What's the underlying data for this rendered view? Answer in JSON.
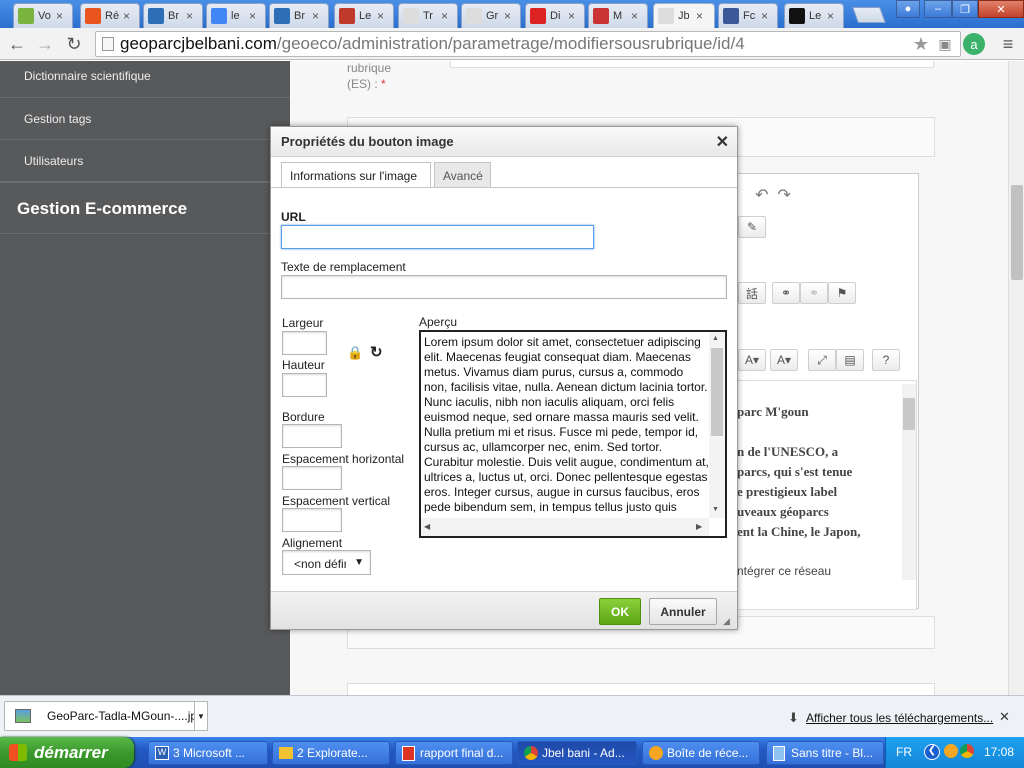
{
  "browser": {
    "tabs": [
      {
        "label": "Vo",
        "fav": "#7ab43e"
      },
      {
        "label": "Ré",
        "fav": "#e8551d"
      },
      {
        "label": "Br",
        "fav": "#2c6fb7"
      },
      {
        "label": "le",
        "fav": "#4285f4"
      },
      {
        "label": "Br",
        "fav": "#2c6fb7"
      },
      {
        "label": "Le",
        "fav": "#c0392b"
      },
      {
        "label": "Tr",
        "fav": "#dddddd"
      },
      {
        "label": "Gr",
        "fav": "#dddddd"
      },
      {
        "label": "Di",
        "fav": "#d22"
      },
      {
        "label": "M",
        "fav": "#c33"
      },
      {
        "label": "Jb",
        "fav": "#dddddd"
      },
      {
        "label": "Fc",
        "fav": "#3b5998"
      },
      {
        "label": "Le",
        "fav": "#111111"
      }
    ],
    "url_host": "geoparcjbelbani.com",
    "url_path": "/geoeco/administration/parametrage/modifiersousrubrique/id/4"
  },
  "sidebar": {
    "items": [
      "Dictionnaire scientifique",
      "Gestion tags",
      "Utilisateurs"
    ],
    "heading": "Gestion E-commerce"
  },
  "form_behind": {
    "label": "rubrique",
    "lang": "(ES) :",
    "required": "*"
  },
  "editor_behind": {
    "lines": [
      "parc M'goun",
      "n de l'UNESCO, a",
      "parcs, qui s'est tenue",
      "e prestigieux label",
      "uveaux géoparcs",
      "ent la Chine, le Japon,",
      "ntégrer ce réseau"
    ]
  },
  "dialog": {
    "title": "Propriétés du bouton image",
    "tabs": [
      "Informations sur l'image",
      "Avancé"
    ],
    "url_label": "URL",
    "url_value": "",
    "alt_label": "Texte de remplacement",
    "width_label": "Largeur",
    "height_label": "Hauteur",
    "border_label": "Bordure",
    "hspace_label": "Espacement horizontal",
    "vspace_label": "Espacement vertical",
    "align_label": "Alignement",
    "align_value": "<non défini>",
    "preview_label": "Aperçu",
    "preview_text": "Lorem ipsum dolor sit amet, consectetuer adipiscing elit. Maecenas feugiat consequat diam. Maecenas metus. Vivamus diam purus, cursus a, commodo non, facilisis vitae, nulla. Aenean dictum lacinia tortor. Nunc iaculis, nibh non iaculis aliquam, orci felis euismod neque, sed ornare massa mauris sed velit. Nulla pretium mi et risus. Fusce mi pede, tempor id, cursus ac, ullamcorper nec, enim. Sed tortor. Curabitur molestie. Duis velit augue, condimentum at, ultrices a, luctus ut, orci. Donec pellentesque egestas eros. Integer cursus, augue in cursus faucibus, eros pede bibendum sem, in tempus tellus justo quis ligula. Etiam eget tortor.",
    "ok_label": "OK",
    "cancel_label": "Annuler"
  },
  "downloads": {
    "file": "GeoParc-Tadla-MGoun-....jpg",
    "show_all": "Afficher tous les téléchargements..."
  },
  "taskbar": {
    "start": "démarrer",
    "tasks": [
      "3 Microsoft ...",
      "2 Explorate...",
      "rapport final d...",
      "Jbel bani - Ad...",
      "Boîte de réce...",
      "Sans titre - Bl..."
    ],
    "lang": "FR",
    "clock": "17:08"
  }
}
